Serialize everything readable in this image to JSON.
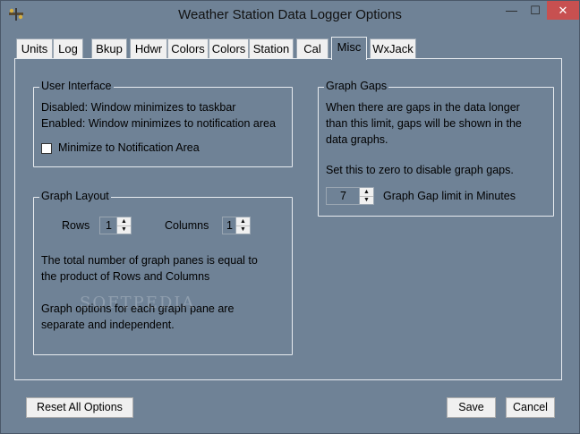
{
  "window": {
    "title": "Weather Station Data Logger Options",
    "minimize": "—",
    "maximize": "☐",
    "close": "✕"
  },
  "tabs": [
    {
      "label": "Units"
    },
    {
      "label": "Log"
    },
    {
      "label": "Bkup"
    },
    {
      "label": "Hdwr"
    },
    {
      "label": "Colors"
    },
    {
      "label": "Colors"
    },
    {
      "label": "Station"
    },
    {
      "label": "Cal"
    },
    {
      "label": "Misc",
      "active": true
    },
    {
      "label": "WxJack"
    }
  ],
  "user_interface": {
    "title": "User Interface",
    "line1": "Disabled: Window minimizes to taskbar",
    "line2": "Enabled: Window minimizes to notification area",
    "checkbox_label": "Minimize to Notification Area",
    "checked": false
  },
  "graph_layout": {
    "title": "Graph Layout",
    "rows_label": "Rows",
    "rows_value": "1",
    "columns_label": "Columns",
    "columns_value": "1",
    "desc1_line1": "The total number of graph panes is equal to",
    "desc1_line2": "the product of Rows and Columns",
    "desc2_line1": "Graph options for each graph pane are",
    "desc2_line2": "separate and independent."
  },
  "graph_gaps": {
    "title": "Graph Gaps",
    "line1": "When there are gaps in the data longer",
    "line2": "than this limit, gaps will be shown in the",
    "line3": "data graphs.",
    "line4": "Set this to zero to disable graph gaps.",
    "limit_value": "7",
    "limit_label": "Graph Gap limit in Minutes"
  },
  "watermark": "SOFTPEDIA",
  "footer": {
    "reset_label": "Reset All Options",
    "save_label": "Save",
    "cancel_label": "Cancel"
  }
}
